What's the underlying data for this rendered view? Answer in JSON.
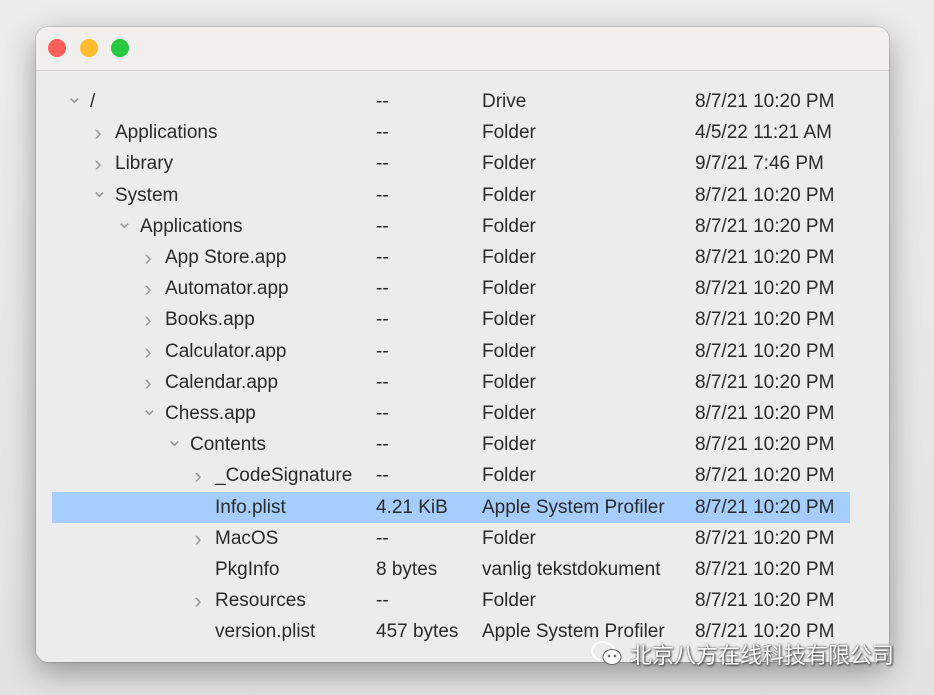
{
  "window": {
    "controls": [
      "close",
      "minimize",
      "zoom"
    ]
  },
  "rows": [
    {
      "name": "/",
      "size": "--",
      "kind": "Drive",
      "date": "8/7/21 10:20 PM",
      "depth": 0,
      "disclosure": "expanded"
    },
    {
      "name": "Applications",
      "size": "--",
      "kind": "Folder",
      "date": "4/5/22 11:21 AM",
      "depth": 1,
      "disclosure": "collapsed"
    },
    {
      "name": "Library",
      "size": "--",
      "kind": "Folder",
      "date": "9/7/21 7:46 PM",
      "depth": 1,
      "disclosure": "collapsed"
    },
    {
      "name": "System",
      "size": "--",
      "kind": "Folder",
      "date": "8/7/21 10:20 PM",
      "depth": 1,
      "disclosure": "expanded"
    },
    {
      "name": "Applications",
      "size": "--",
      "kind": "Folder",
      "date": "8/7/21 10:20 PM",
      "depth": 2,
      "disclosure": "expanded"
    },
    {
      "name": "App Store.app",
      "size": "--",
      "kind": "Folder",
      "date": "8/7/21 10:20 PM",
      "depth": 3,
      "disclosure": "collapsed"
    },
    {
      "name": "Automator.app",
      "size": "--",
      "kind": "Folder",
      "date": "8/7/21 10:20 PM",
      "depth": 3,
      "disclosure": "collapsed"
    },
    {
      "name": "Books.app",
      "size": "--",
      "kind": "Folder",
      "date": "8/7/21 10:20 PM",
      "depth": 3,
      "disclosure": "collapsed"
    },
    {
      "name": "Calculator.app",
      "size": "--",
      "kind": "Folder",
      "date": "8/7/21 10:20 PM",
      "depth": 3,
      "disclosure": "collapsed"
    },
    {
      "name": "Calendar.app",
      "size": "--",
      "kind": "Folder",
      "date": "8/7/21 10:20 PM",
      "depth": 3,
      "disclosure": "collapsed"
    },
    {
      "name": "Chess.app",
      "size": "--",
      "kind": "Folder",
      "date": "8/7/21 10:20 PM",
      "depth": 3,
      "disclosure": "expanded"
    },
    {
      "name": "Contents",
      "size": "--",
      "kind": "Folder",
      "date": "8/7/21 10:20 PM",
      "depth": 4,
      "disclosure": "expanded"
    },
    {
      "name": "_CodeSignature",
      "size": "--",
      "kind": "Folder",
      "date": "8/7/21 10:20 PM",
      "depth": 5,
      "disclosure": "collapsed"
    },
    {
      "name": "Info.plist",
      "size": "4.21 KiB",
      "kind": "Apple System Profiler",
      "date": "8/7/21 10:20 PM",
      "depth": 5,
      "disclosure": "none",
      "selected": true
    },
    {
      "name": "MacOS",
      "size": "--",
      "kind": "Folder",
      "date": "8/7/21 10:20 PM",
      "depth": 5,
      "disclosure": "collapsed"
    },
    {
      "name": "PkgInfo",
      "size": "8 bytes",
      "kind": "vanlig tekstdokument",
      "date": "8/7/21 10:20 PM",
      "depth": 5,
      "disclosure": "none"
    },
    {
      "name": "Resources",
      "size": "--",
      "kind": "Folder",
      "date": "8/7/21 10:20 PM",
      "depth": 5,
      "disclosure": "collapsed"
    },
    {
      "name": "version.plist",
      "size": "457 bytes",
      "kind": "Apple System Profiler",
      "date": "8/7/21 10:20 PM",
      "depth": 5,
      "disclosure": "none"
    }
  ],
  "colors": {
    "selection": "#a5cdfd",
    "close": "#fe5f57",
    "minimize": "#febc2e",
    "zoom": "#28c840"
  },
  "watermark": {
    "text": "北京八方在线科技有限公司",
    "icon": "wechat-icon"
  }
}
